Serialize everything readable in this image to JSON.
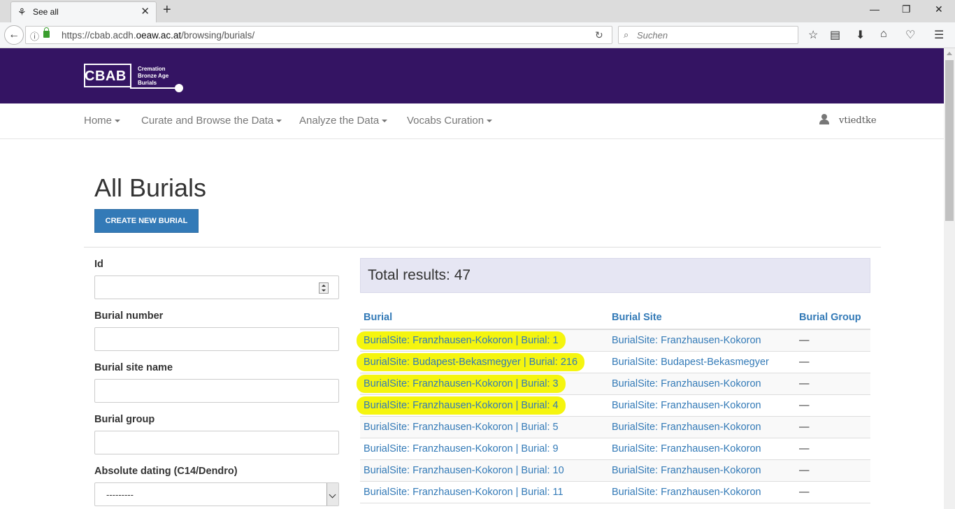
{
  "browser": {
    "tab_title": "See all",
    "url_prefix": "https://cbab.acdh.",
    "url_domain": "oeaw.ac.at",
    "url_path": "/browsing/burials/",
    "search_placeholder": "Suchen"
  },
  "logo": {
    "big": "CBAB",
    "line1": "Cremation",
    "line2": "Bronze Age",
    "line3": "Burials"
  },
  "nav": {
    "items": [
      "Home",
      "Curate and Browse the Data",
      "Analyze the Data",
      "Vocabs Curation"
    ],
    "user": "vtiedtke"
  },
  "page": {
    "title": "All Burials",
    "create_button": "CREATE NEW BURIAL"
  },
  "filters": {
    "id_label": "Id",
    "burial_number_label": "Burial number",
    "burial_site_name_label": "Burial site name",
    "burial_group_label": "Burial group",
    "absolute_dating_label": "Absolute dating (C14/Dendro)",
    "absolute_dating_value": "---------"
  },
  "results": {
    "total": "Total results: 47",
    "headers": [
      "Burial",
      "Burial Site",
      "Burial Group"
    ],
    "rows": [
      {
        "burial": "BurialSite: Franzhausen-Kokoron | Burial: 1",
        "site": "BurialSite: Franzhausen-Kokoron",
        "group": "—"
      },
      {
        "burial": "BurialSite: Budapest-Bekasmegyer | Burial: 216",
        "site": "BurialSite: Budapest-Bekasmegyer",
        "group": "—"
      },
      {
        "burial": "BurialSite: Franzhausen-Kokoron | Burial: 3",
        "site": "BurialSite: Franzhausen-Kokoron",
        "group": "—"
      },
      {
        "burial": "BurialSite: Franzhausen-Kokoron | Burial: 4",
        "site": "BurialSite: Franzhausen-Kokoron",
        "group": "—"
      },
      {
        "burial": "BurialSite: Franzhausen-Kokoron | Burial: 5",
        "site": "BurialSite: Franzhausen-Kokoron",
        "group": "—"
      },
      {
        "burial": "BurialSite: Franzhausen-Kokoron | Burial: 9",
        "site": "BurialSite: Franzhausen-Kokoron",
        "group": "—"
      },
      {
        "burial": "BurialSite: Franzhausen-Kokoron | Burial: 10",
        "site": "BurialSite: Franzhausen-Kokoron",
        "group": "—"
      },
      {
        "burial": "BurialSite: Franzhausen-Kokoron | Burial: 11",
        "site": "BurialSite: Franzhausen-Kokoron",
        "group": "—"
      }
    ]
  },
  "colors": {
    "header_purple": "#341463",
    "link_blue": "#337ab7",
    "highlight_yellow": "#f5f50f"
  }
}
